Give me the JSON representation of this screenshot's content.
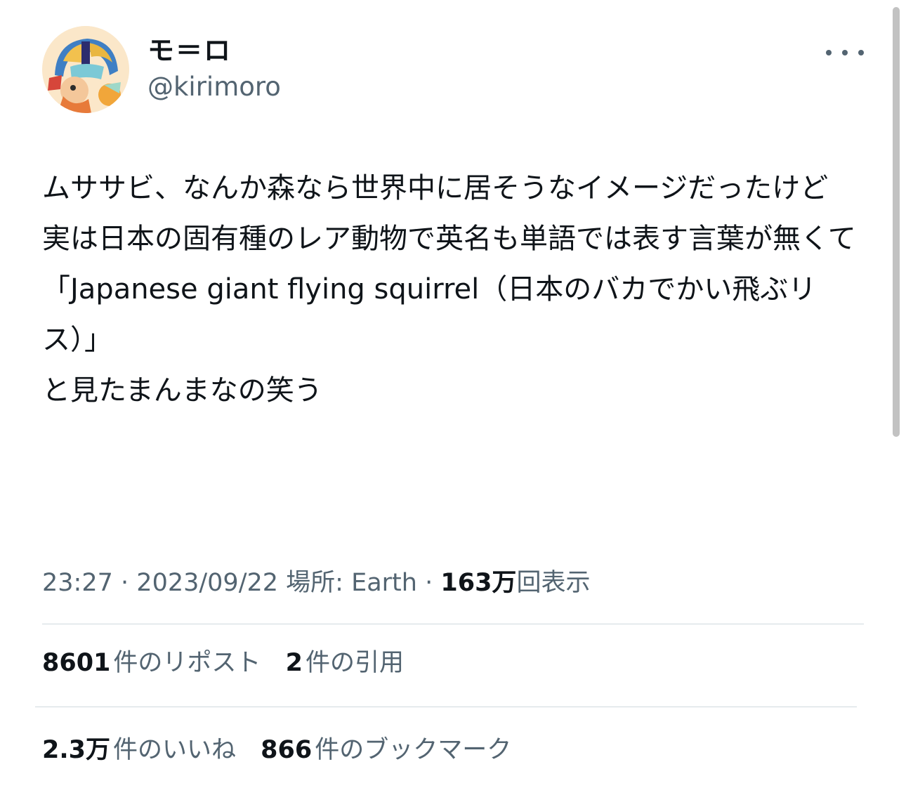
{
  "author": {
    "display_name": "モ＝ロ",
    "handle": "@kirimoro"
  },
  "icons": {
    "avatar": "avatar-image",
    "more": "more-horizontal-icon"
  },
  "tweet": {
    "text": "ムササビ、なんか森なら世界中に居そうなイメージだったけど\n実は日本の固有種のレア動物で英名も単語では表す言葉が無くて\n「Japanese giant flying squirrel（日本のバカでかい飛ぶリス）」\nと見たまんまなの笑う"
  },
  "meta": {
    "time": "23:27",
    "separator": "·",
    "date": "2023/09/22",
    "location": "場所: Earth",
    "views_count": "163万",
    "views_label": "回表示"
  },
  "stats": {
    "reposts": {
      "count": "8601",
      "label": "件のリポスト"
    },
    "quotes": {
      "count": "2",
      "label": "件の引用"
    },
    "likes": {
      "count": "2.3万",
      "label": "件のいいね"
    },
    "bookmarks": {
      "count": "866",
      "label": "件のブックマーク"
    }
  },
  "colors": {
    "text_primary": "#0f1419",
    "text_secondary": "#536471",
    "divider": "#cfd9de"
  }
}
